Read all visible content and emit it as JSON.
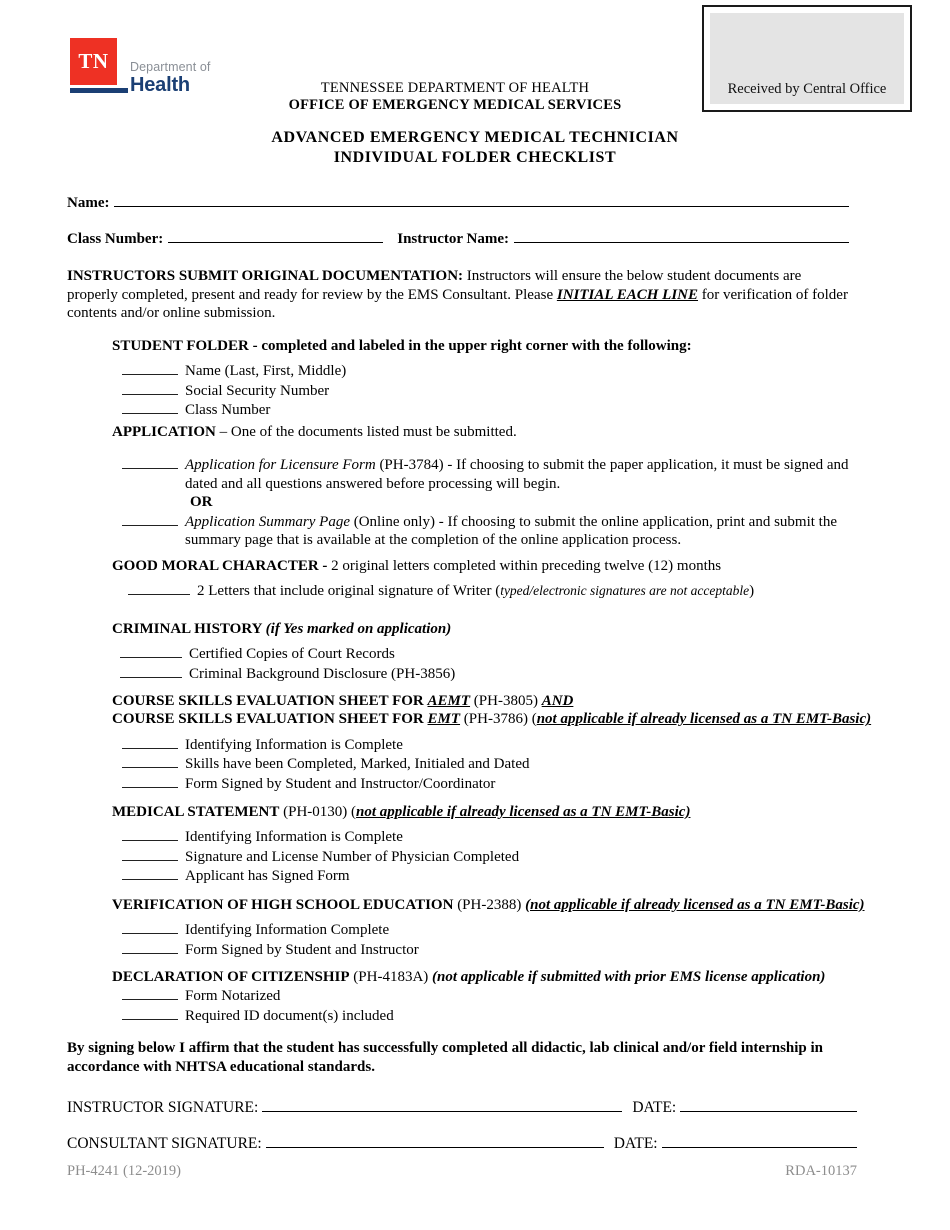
{
  "header": {
    "logo": {
      "mark_text": "TN",
      "dept_text": "Department of",
      "health_text": "Health",
      "mark_color": "#ee3124",
      "bar_color": "#1b3f74",
      "health_color": "#1b3f74",
      "dept_color": "#8a8f96"
    },
    "org_line_1": "TENNESSEE DEPARTMENT OF HEALTH",
    "org_line_2": "OFFICE OF EMERGENCY MEDICAL SERVICES",
    "received_box_label": "Received by Central Office"
  },
  "title": {
    "line_1": "ADVANCED EMERGENCY MEDICAL TECHNICIAN",
    "line_2": "INDIVIDUAL FOLDER CHECKLIST"
  },
  "fields": {
    "name_label": "Name:",
    "class_number_label": "Class Number:",
    "instructor_name_label": "Instructor Name:",
    "name_value": "",
    "class_number_value": "",
    "instructor_name_value": ""
  },
  "intro": {
    "bold_lead": "INSTRUCTORS SUBMIT ORIGINAL DOCUMENTATION:",
    "text_1": " Instructors will ensure the below student documents are properly completed, present and ready for review by the EMS Consultant.  Please ",
    "emphasis": "INITIAL EACH LINE",
    "text_2": " for verification of folder contents and/or online submission."
  },
  "sections": [
    {
      "id": "student-folder",
      "heading_bold": "STUDENT FOLDER",
      "heading_rest": " - completed and labeled in the upper right corner with the following:",
      "items": [
        {
          "text": "Name (Last, First, Middle)"
        },
        {
          "text": "Social Security Number"
        },
        {
          "text": "Class Number"
        }
      ]
    },
    {
      "id": "application",
      "heading_bold": "APPLICATION",
      "heading_rest": " – One of the documents listed must be submitted.",
      "items": [
        {
          "italic_lead": "Application for Licensure Form",
          "text": " (PH-3784) - If choosing to submit the paper application, it must be signed and dated and all questions answered before processing will begin."
        },
        {
          "or_label": "OR"
        },
        {
          "italic_lead": "Application Summary Page",
          "text": " (Online only) - If choosing to submit the online application, print and submit the summary page that is available at the completion of the online application process."
        }
      ]
    },
    {
      "id": "good-moral-character",
      "heading_bold": "GOOD MORAL CHARACTER -",
      "heading_rest": " 2 original letters completed within preceding twelve (12) months",
      "items": [
        {
          "text": "2 Letters that include original signature of Writer (",
          "italic_tail": "typed/electronic signatures are not acceptable",
          "text_end": ")"
        }
      ]
    },
    {
      "id": "criminal-history",
      "heading_bold": "CRIMINAL HISTORY ",
      "heading_italic": "(if Yes marked on application)",
      "items": [
        {
          "text": "Certified Copies of Court Records"
        },
        {
          "text": "Criminal Background Disclosure (PH-3856)"
        }
      ]
    },
    {
      "id": "course-skills",
      "heading_line_1_a": "COURSE SKILLS EVALUATION SHEET FOR ",
      "heading_line_1_em": "AEMT",
      "heading_line_1_b": " (PH-3805) ",
      "heading_line_1_em2": "AND",
      "heading_line_2_a": "COURSE SKILLS EVALUATION SHEET FOR ",
      "heading_line_2_em": "EMT",
      "heading_line_2_b": " (PH-3786) (",
      "heading_line_2_note": "not applicable if already licensed as a TN EMT-Basic)",
      "items": [
        {
          "text": "Identifying Information is Complete"
        },
        {
          "text": "Skills have been Completed, Marked, Initialed and Dated"
        },
        {
          "text": "Form Signed by Student and Instructor/Coordinator"
        }
      ]
    },
    {
      "id": "medical-statement",
      "heading_bold": "MEDICAL STATEMENT",
      "heading_rest": " (PH-0130) (",
      "heading_note": "not applicable if already licensed as a TN EMT-Basic)",
      "items": [
        {
          "text": "Identifying Information is Complete"
        },
        {
          "text": "Signature and License Number of Physician Completed"
        },
        {
          "text": "Applicant has Signed Form"
        }
      ]
    },
    {
      "id": "high-school-verification",
      "heading_bold": "VERIFICATION OF HIGH SCHOOL EDUCATION",
      "heading_rest": " (PH-2388) ",
      "heading_note": "(not applicable if already licensed as a TN EMT-Basic)",
      "items": [
        {
          "text": "Identifying Information Complete"
        },
        {
          "text": "Form Signed by Student and Instructor"
        }
      ]
    },
    {
      "id": "declaration-citizenship",
      "heading_bold": "DECLARATION OF CITIZENSHIP",
      "heading_rest": " (PH-4183A) ",
      "heading_note": "(not applicable if submitted with prior EMS license application)",
      "items": [
        {
          "text": "Form Notarized"
        },
        {
          "text": "Required ID document(s) included"
        }
      ]
    }
  ],
  "affirmation": "By signing below I affirm that the student has successfully completed all didactic, lab clinical and/or field internship in accordance with NHTSA educational standards.",
  "signatures": {
    "instructor_label": "INSTRUCTOR SIGNATURE:",
    "consultant_label": "CONSULTANT SIGNATURE:",
    "date_label_1": "DATE:",
    "date_label_2": "DATE:",
    "instructor_value": "",
    "consultant_value": "",
    "date_value_1": "",
    "date_value_2": ""
  },
  "footer": {
    "left": "PH-4241 (12-2019)",
    "right": "RDA-10137"
  }
}
